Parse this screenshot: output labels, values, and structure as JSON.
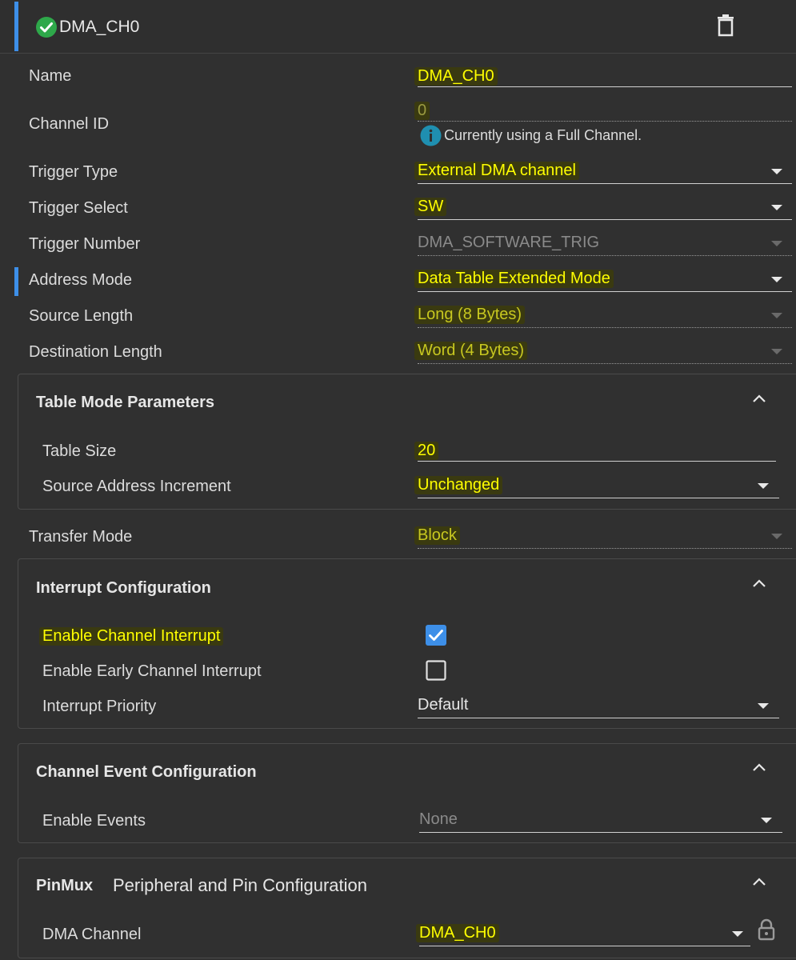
{
  "header": {
    "title": "DMA_CH0"
  },
  "fields": {
    "name": {
      "label": "Name",
      "value": "DMA_CH0"
    },
    "channel_id": {
      "label": "Channel ID",
      "value": "0",
      "info": "Currently using a Full Channel."
    },
    "trigger_type": {
      "label": "Trigger Type",
      "value": "External DMA channel"
    },
    "trigger_select": {
      "label": "Trigger Select",
      "value": "SW"
    },
    "trigger_number": {
      "label": "Trigger Number",
      "value": "DMA_SOFTWARE_TRIG"
    },
    "address_mode": {
      "label": "Address Mode",
      "value": "Data Table Extended Mode"
    },
    "source_length": {
      "label": "Source Length",
      "value": "Long (8 Bytes)"
    },
    "destination_length": {
      "label": "Destination Length",
      "value": "Word (4 Bytes)"
    },
    "transfer_mode": {
      "label": "Transfer Mode",
      "value": "Block"
    }
  },
  "table_mode": {
    "title": "Table Mode Parameters",
    "table_size": {
      "label": "Table Size",
      "value": "20"
    },
    "source_addr_inc": {
      "label": "Source Address Increment",
      "value": "Unchanged"
    }
  },
  "interrupt": {
    "title": "Interrupt Configuration",
    "enable_channel": {
      "label": "Enable Channel Interrupt",
      "checked": true
    },
    "enable_early": {
      "label": "Enable Early Channel Interrupt",
      "checked": false
    },
    "priority": {
      "label": "Interrupt Priority",
      "value": "Default"
    }
  },
  "events": {
    "title": "Channel Event Configuration",
    "enable_events": {
      "label": "Enable Events",
      "value": "None"
    }
  },
  "pinmux": {
    "title_bold": "PinMux",
    "title": "Peripheral and Pin Configuration",
    "dma_channel": {
      "label": "DMA Channel",
      "value": "DMA_CH0"
    }
  },
  "colors": {
    "accent": "#3d8fe8",
    "highlight": "#ffff00",
    "check_green": "#2ea84a",
    "info_blue": "#1f8fb0"
  },
  "icons": [
    "check-circle-icon",
    "trash-icon",
    "info-icon",
    "chevron-up-icon",
    "chevron-down-icon",
    "lock-icon"
  ]
}
